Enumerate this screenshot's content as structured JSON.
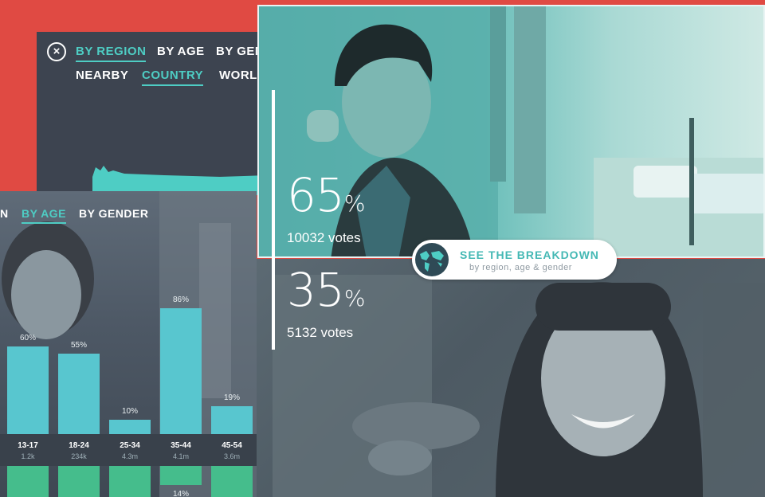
{
  "region_card": {
    "close_icon": "close-icon",
    "primary_tabs": [
      "BY REGION",
      "BY AGE",
      "BY GEN"
    ],
    "secondary_tabs": [
      "NEARBY",
      "COUNTRY",
      "WORL"
    ],
    "colors": {
      "background": "#3d4450",
      "accent": "#4ecdc4"
    }
  },
  "age_card": {
    "tabs": [
      "N",
      "BY AGE",
      "BY GENDER"
    ],
    "bars": [
      {
        "label": "13-17",
        "pct": "60%",
        "value": 60,
        "count": "1.2k"
      },
      {
        "label": "18-24",
        "pct": "55%",
        "value": 55,
        "count": "234k"
      },
      {
        "label": "25-34",
        "pct": "10%",
        "value": 10,
        "count": "4.3m"
      },
      {
        "label": "35-44",
        "pct": "86%",
        "value": 86,
        "count": "4.1m",
        "low_pct": "14%"
      },
      {
        "label": "45-54",
        "pct": "19%",
        "value": 19,
        "count": "3.6m"
      }
    ],
    "colors": {
      "bar": "#58c6cf",
      "bar_lower": "#45bd8c"
    }
  },
  "poll": {
    "option_a": {
      "percent": "65",
      "sign": "%",
      "votes": "10032 votes"
    },
    "option_b": {
      "percent": "35",
      "sign": "%",
      "votes": "5132 votes"
    }
  },
  "cta": {
    "icon": "globe-icon",
    "title": "SEE THE BREAKDOWN",
    "subtitle": "by region, age & gender",
    "colors": {
      "title": "#44b8b4"
    }
  },
  "background": {
    "color": "#e04a43"
  }
}
